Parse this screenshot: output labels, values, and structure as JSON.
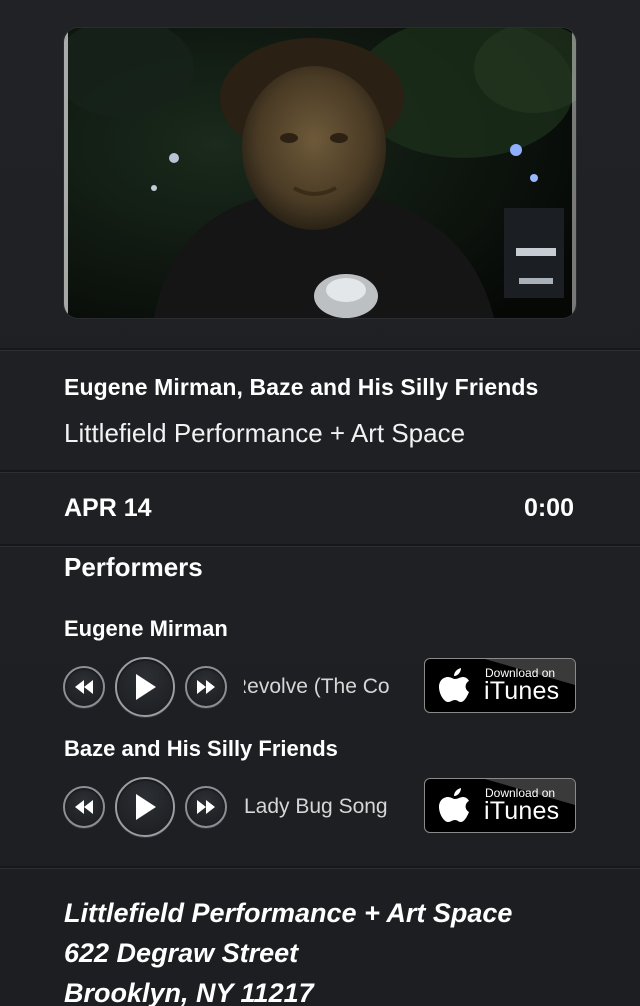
{
  "event": {
    "title": "Eugene Mirman, Baze and His Silly Friends",
    "venue": "Littlefield Performance + Art Space",
    "date": "APR 14",
    "time": "0:00"
  },
  "performers_heading": "Performers",
  "performers": [
    {
      "name": "Eugene Mirman",
      "track": "Revolve (The Co",
      "store_badge": {
        "small": "Download on",
        "big": "iTunes"
      }
    },
    {
      "name": "Baze and His Silly Friends",
      "track": "Lady Bug Song",
      "store_badge": {
        "small": "Download on",
        "big": "iTunes"
      }
    }
  ],
  "address": {
    "line1": "Littlefield Performance + Art Space",
    "line2": "622 Degraw Street",
    "line3": "Brooklyn, NY 11217"
  },
  "icons": {
    "rewind": "rewind-icon",
    "play": "play-icon",
    "fast_forward": "fast-forward-icon",
    "apple": "apple-icon"
  },
  "colors": {
    "background": "#1e2023",
    "text": "#ffffff",
    "muted_text": "#d6d6d6"
  }
}
